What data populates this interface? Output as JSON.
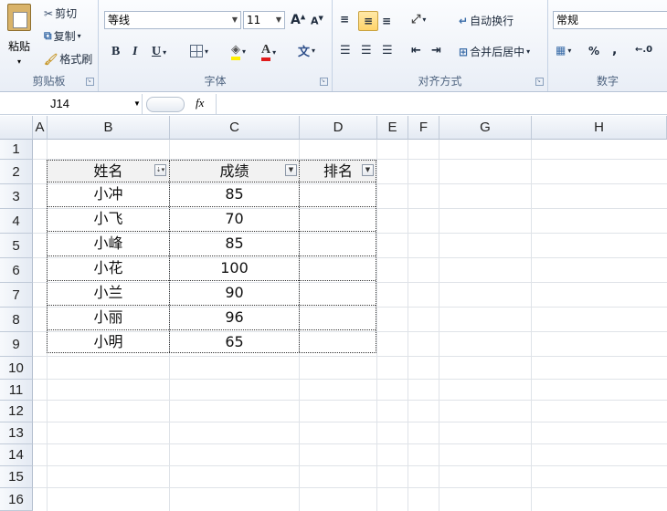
{
  "ribbon": {
    "clipboard": {
      "paste": "粘贴",
      "cut": "剪切",
      "copy": "复制",
      "format_painter": "格式刷",
      "group_label": "剪贴板"
    },
    "font": {
      "font_name": "等线",
      "font_size": "11",
      "group_label": "字体",
      "bold": "B",
      "italic": "I",
      "underline": "U"
    },
    "alignment": {
      "wrap_text": "自动换行",
      "merge_center": "合并后居中",
      "group_label": "对齐方式"
    },
    "number": {
      "format": "常规",
      "percent": "%",
      "comma": ",",
      "group_label": "数字"
    }
  },
  "formula_bar": {
    "name_box": "J14",
    "fx": "fx",
    "formula": ""
  },
  "columns": [
    "A",
    "B",
    "C",
    "D",
    "E",
    "F",
    "G",
    "H"
  ],
  "rows": [
    "1",
    "2",
    "3",
    "4",
    "5",
    "6",
    "7",
    "8",
    "9",
    "10",
    "11",
    "12",
    "13",
    "14",
    "15",
    "16"
  ],
  "table": {
    "headers": [
      "姓名",
      "成绩",
      "排名"
    ],
    "data": [
      [
        "小冲",
        "85",
        ""
      ],
      [
        "小飞",
        "70",
        ""
      ],
      [
        "小峰",
        "85",
        ""
      ],
      [
        "小花",
        "100",
        ""
      ],
      [
        "小兰",
        "90",
        ""
      ],
      [
        "小丽",
        "96",
        ""
      ],
      [
        "小明",
        "65",
        ""
      ]
    ]
  }
}
